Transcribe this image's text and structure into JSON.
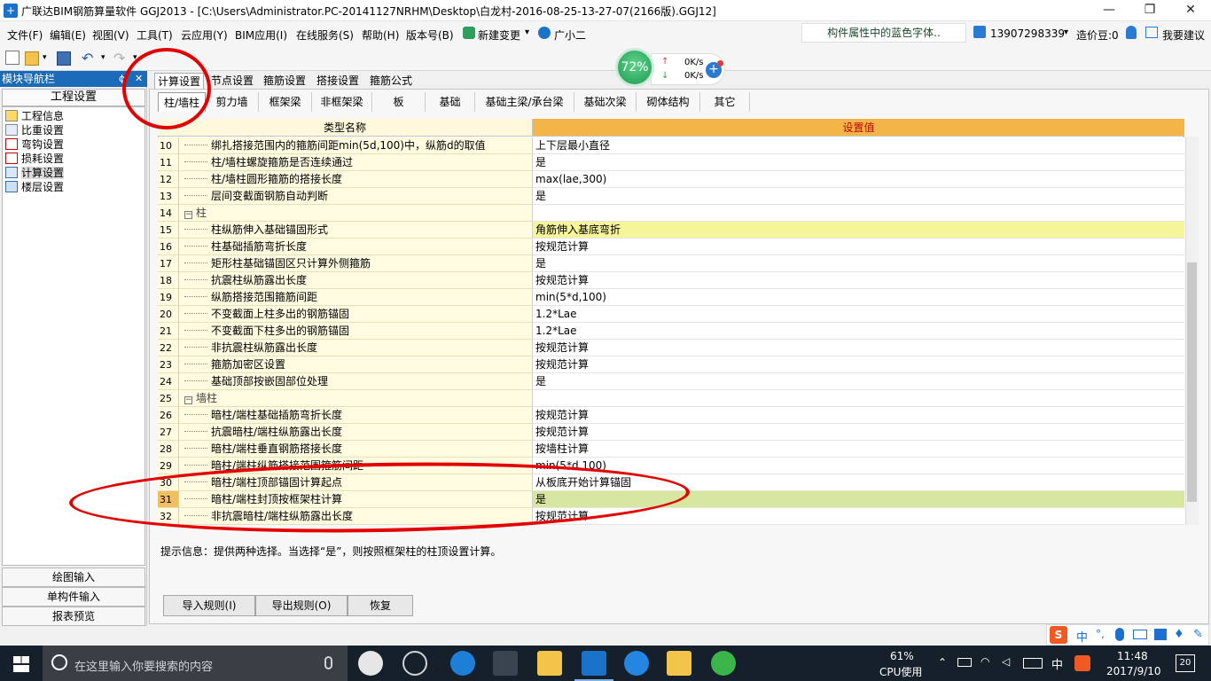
{
  "window": {
    "title": "广联达BIM钢筋算量软件 GGJ2013 - [C:\\Users\\Administrator.PC-20141127NRHM\\Desktop\\白龙村-2016-08-25-13-27-07(2166版).GGJ12]",
    "minimize": "—",
    "maximize": "❐",
    "close": "✕"
  },
  "menu": {
    "items": [
      "文件(F)",
      "编辑(E)",
      "视图(V)",
      "工具(T)",
      "云应用(Y)",
      "BIM应用(I)",
      "在线服务(S)",
      "帮助(H)",
      "版本号(B)",
      "新建变更",
      "广小二"
    ],
    "property_hint": "构件属性中的蓝色字体..",
    "phone": "13907298339",
    "price_beans": "造价豆:0",
    "suggest": "我要建议"
  },
  "speed": {
    "percent": "72%",
    "up": "0K/s",
    "down": "0K/s"
  },
  "nav": {
    "header": "模块导航栏",
    "pin": "ɸ",
    "close": "✕",
    "section": "工程设置",
    "items": [
      "工程信息",
      "比重设置",
      "弯钩设置",
      "损耗设置",
      "计算设置",
      "楼层设置"
    ],
    "bottom": [
      "绘图输入",
      "单构件输入",
      "报表预览"
    ]
  },
  "main_tabs": [
    "计算设置",
    "节点设置",
    "箍筋设置",
    "搭接设置",
    "箍筋公式"
  ],
  "sub_tabs": [
    "柱/墙柱",
    "剪力墙",
    "框架梁",
    "非框架梁",
    "板",
    "基础",
    "基础主梁/承台梁",
    "基础次梁",
    "砌体结构",
    "其它"
  ],
  "grid": {
    "col_name": "类型名称",
    "col_value": "设置值",
    "rows": [
      {
        "n": "10",
        "name": "绑扎搭接范围内的箍筋间距min(5d,100)中，纵筋d的取值",
        "value": "上下层最小直径"
      },
      {
        "n": "11",
        "name": "柱/墙柱螺旋箍筋是否连续通过",
        "value": "是"
      },
      {
        "n": "12",
        "name": "柱/墙柱圆形箍筋的搭接长度",
        "value": "max(lae,300)"
      },
      {
        "n": "13",
        "name": "层间变截面钢筋自动判断",
        "value": "是"
      },
      {
        "n": "14",
        "name": "柱",
        "value": "",
        "group": true
      },
      {
        "n": "15",
        "name": "柱纵筋伸入基础锚固形式",
        "value": "角筋伸入基底弯折",
        "highlight": true
      },
      {
        "n": "16",
        "name": "柱基础插筋弯折长度",
        "value": "按规范计算"
      },
      {
        "n": "17",
        "name": "矩形柱基础锚固区只计算外侧箍筋",
        "value": "是"
      },
      {
        "n": "18",
        "name": "抗震柱纵筋露出长度",
        "value": "按规范计算"
      },
      {
        "n": "19",
        "name": "纵筋搭接范围箍筋间距",
        "value": "min(5*d,100)"
      },
      {
        "n": "20",
        "name": "不变截面上柱多出的钢筋锚固",
        "value": "1.2*Lae"
      },
      {
        "n": "21",
        "name": "不变截面下柱多出的钢筋锚固",
        "value": "1.2*Lae"
      },
      {
        "n": "22",
        "name": "非抗震柱纵筋露出长度",
        "value": "按规范计算"
      },
      {
        "n": "23",
        "name": "箍筋加密区设置",
        "value": "按规范计算"
      },
      {
        "n": "24",
        "name": "基础顶部按嵌固部位处理",
        "value": "是"
      },
      {
        "n": "25",
        "name": "墙柱",
        "value": "",
        "group": true
      },
      {
        "n": "26",
        "name": "暗柱/端柱基础插筋弯折长度",
        "value": "按规范计算"
      },
      {
        "n": "27",
        "name": "抗震暗柱/端柱纵筋露出长度",
        "value": "按规范计算"
      },
      {
        "n": "28",
        "name": "暗柱/端柱垂直钢筋搭接长度",
        "value": "按墙柱计算"
      },
      {
        "n": "29",
        "name": "暗柱/端柱纵筋搭接范围箍筋间距",
        "value": "min(5*d,100)"
      },
      {
        "n": "30",
        "name": "暗柱/端柱顶部锚固计算起点",
        "value": "从板底开始计算锚固"
      },
      {
        "n": "31",
        "name": "暗柱/端柱封顶按框架柱计算",
        "value": "是",
        "selected": true
      },
      {
        "n": "32",
        "name": "非抗震暗柱/端柱纵筋露出长度",
        "value": "按规范计算"
      }
    ]
  },
  "hint": "提示信息：提供两种选择。当选择“是”，则按照框架柱的柱顶设置计算。",
  "buttons": {
    "import": "导入规则(I)",
    "export": "导出规则(O)",
    "restore": "恢复"
  },
  "ime": {
    "label": "中"
  },
  "taskbar": {
    "search_placeholder": "在这里输入你要搜索的内容",
    "cpu_percent": "61%",
    "cpu_label": "CPU使用",
    "lang": "中",
    "time": "11:48",
    "date": "2017/9/10",
    "notifications": "20"
  },
  "colors": {
    "nav_header": "#1c6bb8",
    "header_orange": "#f3b548",
    "row_yellow": "#fffbe0",
    "highlight": "#f7f59a",
    "selected": "#d8e7a0",
    "annotation_red": "#e20000"
  }
}
